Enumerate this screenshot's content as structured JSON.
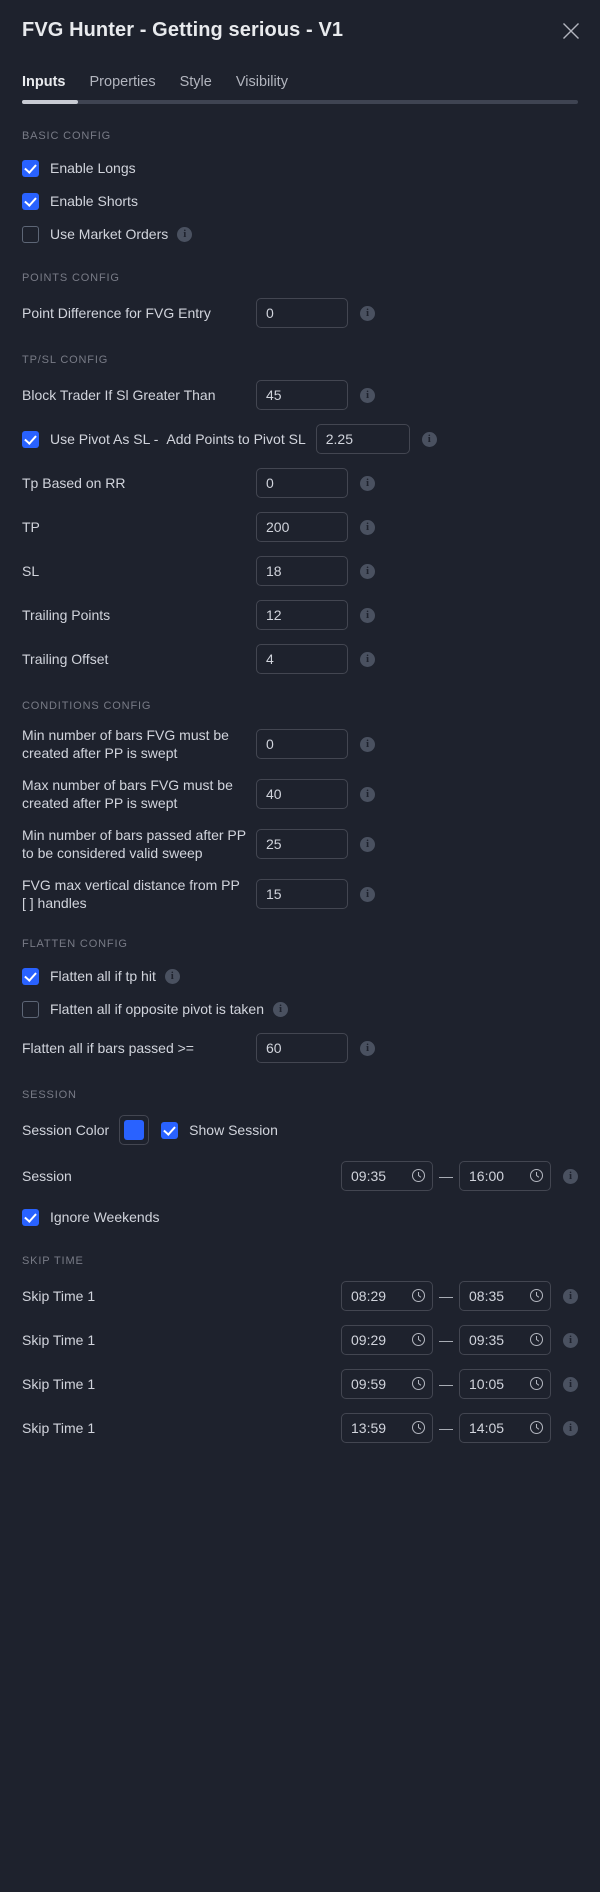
{
  "window": {
    "title": "FVG Hunter - Getting serious - V1",
    "close_icon": "close-icon"
  },
  "tabs": [
    {
      "label": "Inputs",
      "active": true
    },
    {
      "label": "Properties",
      "active": false
    },
    {
      "label": "Style",
      "active": false
    },
    {
      "label": "Visibility",
      "active": false
    }
  ],
  "sections": {
    "basic_config": {
      "title": "BASIC CONFIG",
      "enable_longs": {
        "label": "Enable Longs",
        "checked": true
      },
      "enable_shorts": {
        "label": "Enable Shorts",
        "checked": true
      },
      "use_market_orders": {
        "label": "Use Market Orders",
        "checked": false
      }
    },
    "points_config": {
      "title": "POINTS CONFIG",
      "point_difference": {
        "label": "Point Difference for FVG Entry",
        "value": "0"
      }
    },
    "tpsl_config": {
      "title": "TP/SL CONFIG",
      "block_trader": {
        "label": "Block Trader If Sl Greater Than",
        "value": "45"
      },
      "use_pivot_as_sl": {
        "label": "Use Pivot As SL -",
        "checked": true
      },
      "add_points_to_pivot_sl": {
        "label": "Add Points to Pivot SL",
        "value": "2.25"
      },
      "tp_based_on_rr": {
        "label": "Tp Based on RR",
        "value": "0"
      },
      "tp": {
        "label": "TP",
        "value": "200"
      },
      "sl": {
        "label": "SL",
        "value": "18"
      },
      "trailing_points": {
        "label": "Trailing Points",
        "value": "12"
      },
      "trailing_offset": {
        "label": "Trailing Offset",
        "value": "4"
      }
    },
    "conditions_config": {
      "title": "CONDITIONS CONFIG",
      "items": [
        {
          "label": "Min number of bars FVG must be created after PP is swept",
          "value": "0"
        },
        {
          "label": "Max number of bars FVG must be created after PP is swept",
          "value": "40"
        },
        {
          "label": "Min number of bars passed after PP to be considered valid sweep",
          "value": "25"
        },
        {
          "label": "FVG max vertical distance from PP [ ] handles",
          "value": "15"
        }
      ]
    },
    "flatten_config": {
      "title": "FLATTEN CONFIG",
      "flatten_tp_hit": {
        "label": "Flatten all if tp hit",
        "checked": true
      },
      "flatten_opposite_pivot": {
        "label": "Flatten all if opposite pivot is taken",
        "checked": false
      },
      "flatten_bars_passed": {
        "label": "Flatten all if bars passed >=",
        "value": "60"
      }
    },
    "session": {
      "title": "SESSION",
      "session_color": {
        "label": "Session Color",
        "color": "#2962ff"
      },
      "show_session": {
        "label": "Show Session",
        "checked": true
      },
      "session_time": {
        "label": "Session",
        "start": "09:35",
        "end": "16:00"
      },
      "ignore_weekends": {
        "label": "Ignore Weekends",
        "checked": true
      }
    },
    "skip_time": {
      "title": "SKIP TIME",
      "rows": [
        {
          "label": "Skip Time 1",
          "start": "08:29",
          "end": "08:35"
        },
        {
          "label": "Skip Time 1",
          "start": "09:29",
          "end": "09:35"
        },
        {
          "label": "Skip Time 1",
          "start": "09:59",
          "end": "10:05"
        },
        {
          "label": "Skip Time 1",
          "start": "13:59",
          "end": "14:05"
        }
      ]
    }
  },
  "icons": {
    "info": "i",
    "clock": "clock-icon"
  },
  "colors": {
    "accent": "#2962ff",
    "background": "#1e222d",
    "text": "#d1d4dc",
    "muted": "#787b86",
    "border": "#434651"
  }
}
